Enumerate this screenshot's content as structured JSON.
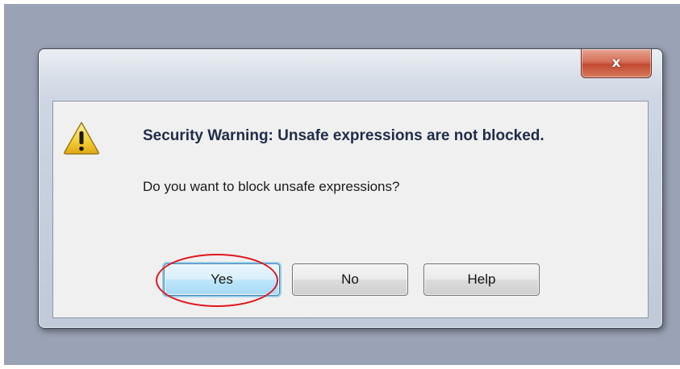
{
  "window": {
    "close_glyph": "x",
    "accent_color": "#c24a30"
  },
  "message": {
    "heading": "Security Warning: Unsafe expressions are not blocked.",
    "question": "Do you want to block unsafe expressions?",
    "icon": "warning-triangle-icon",
    "icon_glyph": "!"
  },
  "buttons": {
    "yes_label": "Yes",
    "no_label": "No",
    "help_label": "Help"
  },
  "annotation": {
    "highlight_color": "#e0171d",
    "highlighted": "Yes"
  }
}
